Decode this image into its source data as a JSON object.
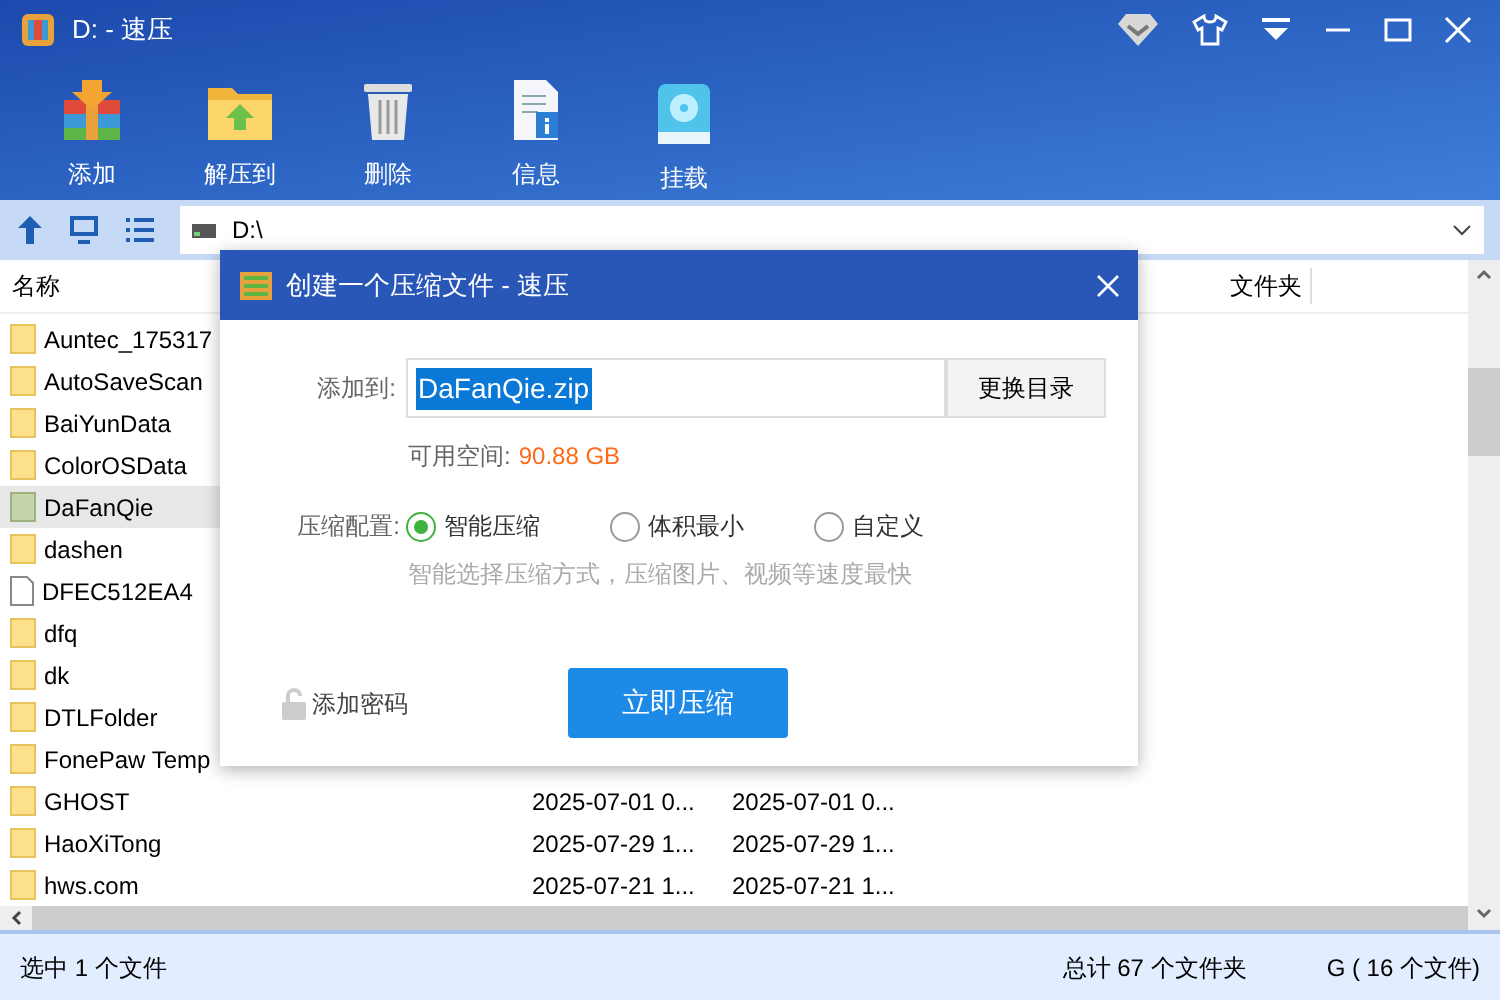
{
  "window": {
    "title": "D: - 速压"
  },
  "toolbar": [
    {
      "label": "添加",
      "kind": "add"
    },
    {
      "label": "解压到",
      "kind": "extract"
    },
    {
      "label": "删除",
      "kind": "delete"
    },
    {
      "label": "信息",
      "kind": "info"
    },
    {
      "label": "挂载",
      "kind": "mount"
    }
  ],
  "address": {
    "value": "D:\\"
  },
  "table": {
    "columns": [
      "名称",
      "文件夹"
    ],
    "rows": [
      {
        "name": "Auntec_175317",
        "kind": "folder",
        "selected": false
      },
      {
        "name": "AutoSaveScan",
        "kind": "folder",
        "selected": false
      },
      {
        "name": "BaiYunData",
        "kind": "folder",
        "selected": false
      },
      {
        "name": "ColorOSData",
        "kind": "folder",
        "selected": false
      },
      {
        "name": "DaFanQie",
        "kind": "folder",
        "selected": true
      },
      {
        "name": "dashen",
        "kind": "folder",
        "selected": false
      },
      {
        "name": "DFEC512EA4",
        "kind": "file",
        "selected": false
      },
      {
        "name": "dfq",
        "kind": "folder",
        "selected": false
      },
      {
        "name": "dk",
        "kind": "folder",
        "selected": false
      },
      {
        "name": "DTLFolder",
        "kind": "folder",
        "selected": false
      },
      {
        "name": "FonePaw Temp",
        "kind": "folder",
        "selected": false
      },
      {
        "name": "GHOST",
        "kind": "folder",
        "selected": false,
        "column_2": "2025-07-01 0...",
        "column_3": "2025-07-01 0..."
      },
      {
        "name": "HaoXiTong",
        "kind": "folder",
        "selected": false,
        "column_2": "2025-07-29 1...",
        "column_3": "2025-07-29 1..."
      },
      {
        "name": "hws.com",
        "kind": "folder",
        "selected": false,
        "column_2": "2025-07-21 1...",
        "column_3": "2025-07-21 1..."
      }
    ]
  },
  "status_bar": {
    "left": "选中 1 个文件",
    "right_1": "总计 67 个文件夹",
    "right_2": "G ( 16 个文件)"
  },
  "dialog": {
    "title": "创建一个压缩文件 - 速压",
    "add_to_label": "添加到:",
    "add_to_value": "DaFanQie.zip",
    "change_dir_button": "更换目录",
    "free_space_label": "可用空间:",
    "free_space_value": "90.88 GB",
    "config_label": "压缩配置:",
    "options": [
      {
        "label": "智能压缩",
        "selected": true
      },
      {
        "label": "体积最小",
        "selected": false
      },
      {
        "label": "自定义",
        "selected": false
      }
    ],
    "hint": "智能选择压缩方式，压缩图片、视频等速度最快",
    "password_link": "添加密码",
    "compress_button": "立即压缩"
  }
}
